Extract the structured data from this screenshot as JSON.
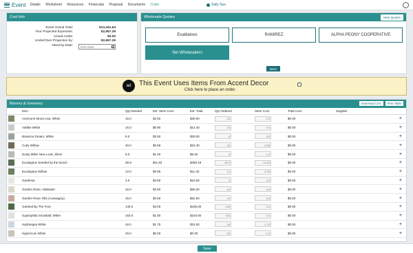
{
  "app": {
    "title": "Event",
    "user": "Sally Sue"
  },
  "nav": [
    "Details",
    "Worksheet",
    "Resources",
    "Financials",
    "Proposal",
    "Documents",
    "Costs"
  ],
  "cost_info": {
    "title": "Cost Info",
    "rows": [
      {
        "label": "Event Grand Total:",
        "value": "$13,341.64"
      },
      {
        "label": "Your Projected Expenses:",
        "value": "$2,657.29"
      },
      {
        "label": "Actual Costs:",
        "value": "$0.00"
      },
      {
        "label": "Under/Over Projection by:",
        "value": "$2,657.29"
      }
    ],
    "need_by_label": "Need by Date:",
    "date_placeholder": "Pick Date"
  },
  "wholesale": {
    "title": "Wholesale Quotes",
    "view_button": "View Quotes",
    "logos": [
      "Esaldaines",
      "RAMIREZ",
      "ALPHA PEONY COOPERATIVE"
    ],
    "set_button": "Set Wholesalers",
    "more_button": "More"
  },
  "banner": {
    "title": "This Event Uses Items From Accent Decor",
    "sub": "Click here to place an order."
  },
  "blooms": {
    "title": "Blooms & Greenery",
    "download": "Download CSV",
    "print": "Print Table",
    "headers": [
      "Item",
      "Qty Needed",
      "Est. Stem Cost",
      "Est. Total",
      "Qty Ordered",
      "Stem Cost",
      "Total Cost",
      "Supplier"
    ],
    "rows": [
      [
        "Anemone Mona Lisa, White",
        "15.0",
        "$2.00",
        "$30.00",
        "16",
        "2.0",
        "$0.00"
      ],
      [
        "Astilbe White",
        "16.0",
        "$0.90",
        "$14.40",
        "16",
        "0.9",
        "$0.00"
      ],
      [
        "Brassica Dream, White",
        "8.0",
        "$3.50",
        "$28.00",
        "8",
        "3.5",
        "$0.00"
      ],
      [
        "Curly Willow",
        "40.0",
        "$0.56",
        "$22.40",
        "40",
        "0.56",
        "$0.00"
      ],
      [
        "Dusty Miller New Look, Silver",
        "5.0",
        "$1.00",
        "$5.00",
        "5",
        "1.0",
        "$0.00"
      ],
      [
        "Eucalyptus Seeded by the bunch",
        "38.9",
        "$11.83",
        "$460.19",
        "38.9",
        "11.83",
        "$0.00"
      ],
      [
        "Eucalyptus Willow",
        "12.0",
        "$0.95",
        "$11.40",
        "12",
        "0.95",
        "$0.00"
      ],
      [
        "Gardenia",
        "3.0",
        "$3.50",
        "$10.50",
        "3",
        "3.5",
        "$0.00"
      ],
      [
        "Garden Rose: Alabaster",
        "16.0",
        "$3.50",
        "$56.00",
        "16",
        "3.5",
        "$0.00"
      ],
      [
        "Garden Rose: Ella (Auswagny)",
        "15.0",
        "$3.50",
        "$52.50",
        "15",
        "3.5",
        "$0.00"
      ],
      [
        "Garland By The Foot",
        "145.0",
        "$3.00",
        "$435.00",
        "145",
        "3.0",
        "$0.00"
      ],
      [
        "Gypsophila Snowball, White",
        "163.0",
        "$1.00",
        "$163.00",
        "163",
        "1.0",
        "$0.00"
      ],
      [
        "Hydrangea White",
        "18.0",
        "$1.75",
        "$31.50",
        "18",
        "1.75",
        "$0.00"
      ],
      [
        "Hypericum White",
        "20.0",
        "$0.00",
        "$0.00",
        "20",
        "0.0",
        "$0.00"
      ]
    ]
  },
  "save_button": "Save"
}
